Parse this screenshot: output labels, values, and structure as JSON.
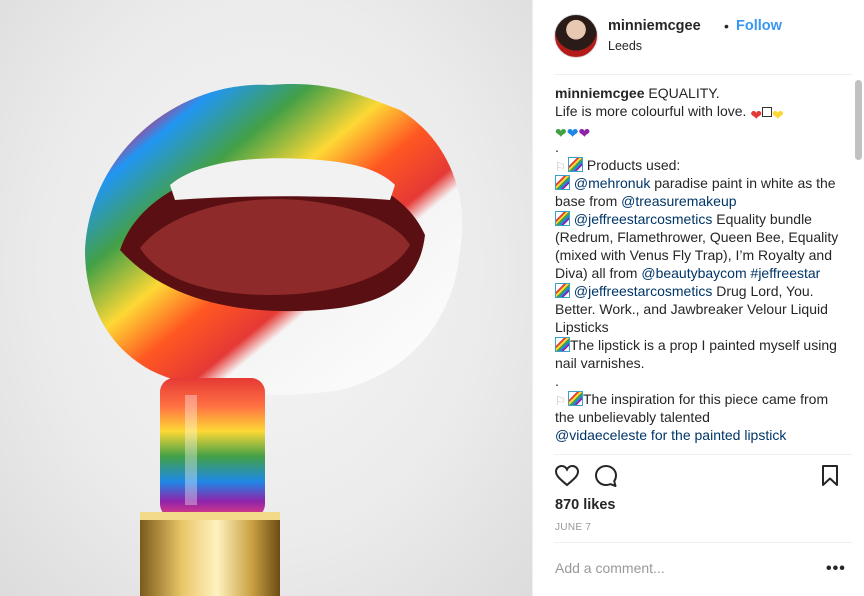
{
  "post": {
    "username": "minniemcgee",
    "separator": "•",
    "follow_label": "Follow",
    "location": "Leeds"
  },
  "caption": {
    "username": "minniemcgee",
    "line1": "EQUALITY.",
    "line2": "Life is more colourful with love.",
    "dot1": ".",
    "products_used": "Products used:",
    "mention1": "@mehronuk",
    "text1": " paradise paint in white as the base from ",
    "mention2": "@treasuremakeup",
    "mention3": "@jeffreestarcosmetics",
    "text2": " Equality bundle (Redrum, Flamethrower, Queen Bee, Equality (mixed with Venus Fly Trap), I’m Royalty and Diva) all from ",
    "mention4": "@beautybaycom",
    "hashtag1": "#jeffreestar",
    "mention5": "@jeffreestarcosmetics",
    "text3": " Drug Lord, You. Better. Work., and Jawbreaker Velour Liquid Lipsticks",
    "text4": "The lipstick is a prop I painted myself using nail varnishes.",
    "dot2": ".",
    "text5": "The inspiration for this piece came from the unbelievably talented",
    "text6": "@vidaeceleste for the painted lipstick"
  },
  "actions": {
    "like_icon": "heart-icon",
    "comment_icon": "comment-bubble-icon",
    "save_icon": "bookmark-icon"
  },
  "likes_text": "870 likes",
  "date_text": "JUNE 7",
  "comment_placeholder": "Add a comment...",
  "more_label": "•••",
  "colors": {
    "link": "#003569",
    "follow": "#3897f0",
    "muted": "#999999"
  }
}
